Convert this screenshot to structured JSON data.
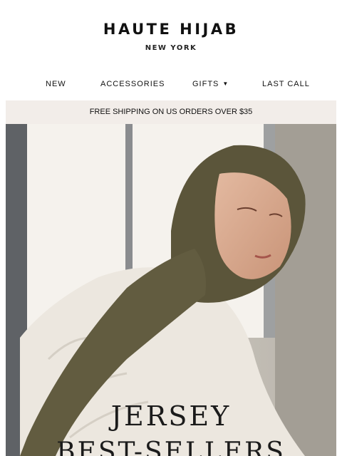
{
  "brand": {
    "name": "HAUTE HIJAB",
    "tagline": "NEW YORK"
  },
  "nav": {
    "items": [
      {
        "label": "NEW"
      },
      {
        "label": "ACCESSORIES"
      },
      {
        "label": "GIFTS",
        "icon": "chevron-down-icon"
      },
      {
        "label": "LAST CALL"
      }
    ]
  },
  "banner": {
    "text": "FREE SHIPPING ON US ORDERS OVER $35"
  },
  "hero": {
    "title_line1": "JERSEY",
    "title_line2": "BEST-SELLERS",
    "colors": {
      "hijab": "#5b553a",
      "sweater": "#ece7df",
      "window": "#f4f1ec",
      "wall": "#cfcac2"
    }
  }
}
